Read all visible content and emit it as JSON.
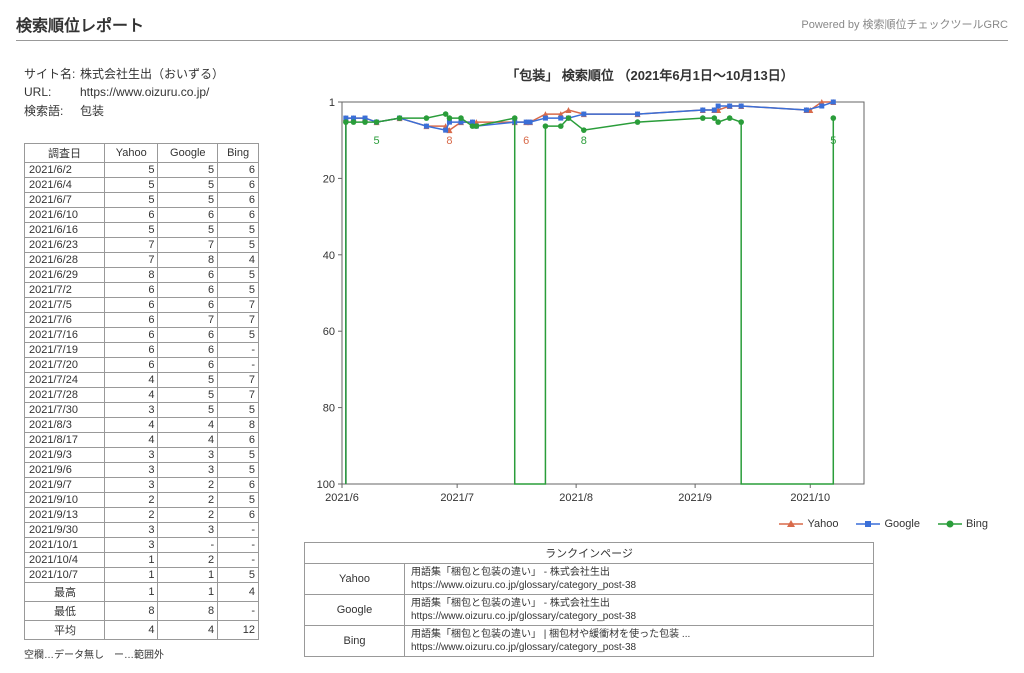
{
  "header": {
    "title": "検索順位レポート",
    "powered": "Powered by 検索順位チェックツールGRC"
  },
  "info": {
    "site_label": "サイト名:",
    "site_value": "株式会社生出（おいずる）",
    "url_label": "URL:",
    "url_value": "https://www.oizuru.co.jp/",
    "keyword_label": "検索語:",
    "keyword_value": "包装"
  },
  "table": {
    "cols": [
      "調査日",
      "Yahoo",
      "Google",
      "Bing"
    ],
    "rows": [
      [
        "2021/6/2",
        "5",
        "5",
        "6"
      ],
      [
        "2021/6/4",
        "5",
        "5",
        "6"
      ],
      [
        "2021/6/7",
        "5",
        "5",
        "6"
      ],
      [
        "2021/6/10",
        "6",
        "6",
        "6"
      ],
      [
        "2021/6/16",
        "5",
        "5",
        "5"
      ],
      [
        "2021/6/23",
        "7",
        "7",
        "5"
      ],
      [
        "2021/6/28",
        "7",
        "8",
        "4"
      ],
      [
        "2021/6/29",
        "8",
        "6",
        "5"
      ],
      [
        "2021/7/2",
        "6",
        "6",
        "5"
      ],
      [
        "2021/7/5",
        "6",
        "6",
        "7"
      ],
      [
        "2021/7/6",
        "6",
        "7",
        "7"
      ],
      [
        "2021/7/16",
        "6",
        "6",
        "5"
      ],
      [
        "2021/7/19",
        "6",
        "6",
        "-"
      ],
      [
        "2021/7/20",
        "6",
        "6",
        "-"
      ],
      [
        "2021/7/24",
        "4",
        "5",
        "7"
      ],
      [
        "2021/7/28",
        "4",
        "5",
        "7"
      ],
      [
        "2021/7/30",
        "3",
        "5",
        "5"
      ],
      [
        "2021/8/3",
        "4",
        "4",
        "8"
      ],
      [
        "2021/8/17",
        "4",
        "4",
        "6"
      ],
      [
        "2021/9/3",
        "3",
        "3",
        "5"
      ],
      [
        "2021/9/6",
        "3",
        "3",
        "5"
      ],
      [
        "2021/9/7",
        "3",
        "2",
        "6"
      ],
      [
        "2021/9/10",
        "2",
        "2",
        "5"
      ],
      [
        "2021/9/13",
        "2",
        "2",
        "6"
      ],
      [
        "2021/9/30",
        "3",
        "3",
        "-"
      ],
      [
        "2021/10/1",
        "3",
        "-",
        "-"
      ],
      [
        "2021/10/4",
        "1",
        "2",
        "-"
      ],
      [
        "2021/10/7",
        "1",
        "1",
        "5"
      ]
    ],
    "summary": [
      [
        "最高",
        "1",
        "1",
        "4"
      ],
      [
        "最低",
        "8",
        "8",
        "-"
      ],
      [
        "平均",
        "4",
        "4",
        "12"
      ]
    ],
    "footnote": "空欄…データ無し　ー…範囲外"
  },
  "chart_title": "「包装」 検索順位 （2021年6月1日～10月13日）",
  "legend": {
    "yahoo": "Yahoo",
    "google": "Google",
    "bing": "Bing"
  },
  "rank_in_page": {
    "heading": "ランクインページ",
    "rows": [
      {
        "engine": "Yahoo",
        "title": "用語集「梱包と包装の違い」 - 株式会社生出",
        "url": "https://www.oizuru.co.jp/glossary/category_post-38"
      },
      {
        "engine": "Google",
        "title": "用語集「梱包と包装の違い」 - 株式会社生出",
        "url": "https://www.oizuru.co.jp/glossary/category_post-38"
      },
      {
        "engine": "Bing",
        "title": "用語集「梱包と包装の違い」 | 梱包材や緩衝材を使った包装 ...",
        "url": "https://www.oizuru.co.jp/glossary/category_post-38"
      }
    ]
  },
  "chart_data": {
    "type": "line",
    "title": "「包装」 検索順位 （2021年6月1日～10月13日）",
    "xlabel": "",
    "ylabel": "",
    "x_ticks": [
      "2021/6",
      "2021/7",
      "2021/8",
      "2021/9",
      "2021/10"
    ],
    "ylim": [
      1,
      100
    ],
    "y_ticks": [
      1,
      20,
      40,
      60,
      80,
      100
    ],
    "y_inverted": true,
    "annotations": [
      {
        "label": "5",
        "series": "Bing",
        "near_x": "2021/6/10",
        "color": "#2a9d3a"
      },
      {
        "label": "8",
        "series": "Yahoo",
        "near_x": "2021/6/29",
        "color": "#d86a4a"
      },
      {
        "label": "6",
        "series": "Yahoo",
        "near_x": "2021/7/19",
        "color": "#d86a4a"
      },
      {
        "label": "8",
        "series": "Bing",
        "near_x": "2021/8/3",
        "color": "#2a9d3a"
      },
      {
        "label": "5",
        "series": "Bing",
        "near_x": "2021/10/7",
        "color": "#2a9d3a"
      }
    ],
    "series": [
      {
        "name": "Yahoo",
        "color": "#d86a4a",
        "marker": "triangle",
        "points": [
          [
            "2021/6/2",
            5
          ],
          [
            "2021/6/4",
            5
          ],
          [
            "2021/6/7",
            5
          ],
          [
            "2021/6/10",
            6
          ],
          [
            "2021/6/16",
            5
          ],
          [
            "2021/6/23",
            7
          ],
          [
            "2021/6/28",
            7
          ],
          [
            "2021/6/29",
            8
          ],
          [
            "2021/7/2",
            6
          ],
          [
            "2021/7/5",
            6
          ],
          [
            "2021/7/6",
            6
          ],
          [
            "2021/7/16",
            6
          ],
          [
            "2021/7/19",
            6
          ],
          [
            "2021/7/20",
            6
          ],
          [
            "2021/7/24",
            4
          ],
          [
            "2021/7/28",
            4
          ],
          [
            "2021/7/30",
            3
          ],
          [
            "2021/8/3",
            4
          ],
          [
            "2021/8/17",
            4
          ],
          [
            "2021/9/3",
            3
          ],
          [
            "2021/9/6",
            3
          ],
          [
            "2021/9/7",
            3
          ],
          [
            "2021/9/10",
            2
          ],
          [
            "2021/9/13",
            2
          ],
          [
            "2021/9/30",
            3
          ],
          [
            "2021/10/1",
            3
          ],
          [
            "2021/10/4",
            1
          ],
          [
            "2021/10/7",
            1
          ]
        ]
      },
      {
        "name": "Google",
        "color": "#3a6fd8",
        "marker": "square",
        "points": [
          [
            "2021/6/2",
            5
          ],
          [
            "2021/6/4",
            5
          ],
          [
            "2021/6/7",
            5
          ],
          [
            "2021/6/10",
            6
          ],
          [
            "2021/6/16",
            5
          ],
          [
            "2021/6/23",
            7
          ],
          [
            "2021/6/28",
            8
          ],
          [
            "2021/6/29",
            6
          ],
          [
            "2021/7/2",
            6
          ],
          [
            "2021/7/5",
            6
          ],
          [
            "2021/7/6",
            7
          ],
          [
            "2021/7/16",
            6
          ],
          [
            "2021/7/19",
            6
          ],
          [
            "2021/7/20",
            6
          ],
          [
            "2021/7/24",
            5
          ],
          [
            "2021/7/28",
            5
          ],
          [
            "2021/7/30",
            5
          ],
          [
            "2021/8/3",
            4
          ],
          [
            "2021/8/17",
            4
          ],
          [
            "2021/9/3",
            3
          ],
          [
            "2021/9/6",
            3
          ],
          [
            "2021/9/7",
            2
          ],
          [
            "2021/9/10",
            2
          ],
          [
            "2021/9/13",
            2
          ],
          [
            "2021/9/30",
            3
          ],
          [
            "2021/10/4",
            2
          ],
          [
            "2021/10/7",
            1
          ]
        ]
      },
      {
        "name": "Bing",
        "color": "#2a9d3a",
        "marker": "circle",
        "points": [
          [
            "2021/6/2",
            6
          ],
          [
            "2021/6/4",
            6
          ],
          [
            "2021/6/7",
            6
          ],
          [
            "2021/6/10",
            6
          ],
          [
            "2021/6/16",
            5
          ],
          [
            "2021/6/23",
            5
          ],
          [
            "2021/6/28",
            4
          ],
          [
            "2021/6/29",
            5
          ],
          [
            "2021/7/2",
            5
          ],
          [
            "2021/7/5",
            7
          ],
          [
            "2021/7/6",
            7
          ],
          [
            "2021/7/16",
            5
          ],
          [
            "2021/7/24",
            7
          ],
          [
            "2021/7/28",
            7
          ],
          [
            "2021/7/30",
            5
          ],
          [
            "2021/8/3",
            8
          ],
          [
            "2021/8/17",
            6
          ],
          [
            "2021/9/3",
            5
          ],
          [
            "2021/9/6",
            5
          ],
          [
            "2021/9/7",
            6
          ],
          [
            "2021/9/10",
            5
          ],
          [
            "2021/9/13",
            6
          ],
          [
            "2021/10/7",
            5
          ]
        ],
        "breaks_after": [
          "2021/7/16",
          "2021/9/13"
        ]
      }
    ]
  }
}
